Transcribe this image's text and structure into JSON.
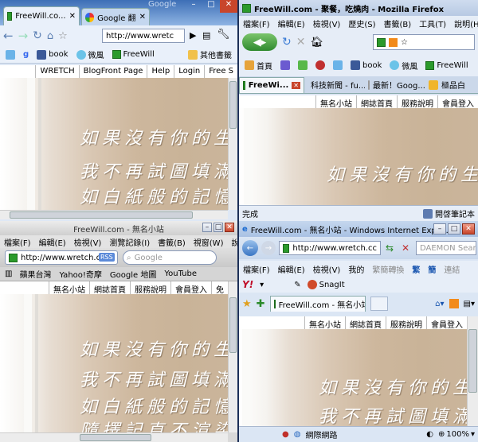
{
  "poem": {
    "line1": "如果沒有你的生命",
    "line2": "我不再試圖填滿色",
    "line3": "如白紙般的記憶，",
    "line4": "隨擇記直不渲染"
  },
  "chrome": {
    "tab1": "FreeWill.co...",
    "tab2": "Google 翻",
    "google_hint": "Google",
    "url": "http://www.wretc",
    "bookmarks": [
      "g",
      "book",
      "微風",
      "FreeWill"
    ],
    "other_bookmarks": "其他書籤",
    "nav_links": [
      "WRETCH",
      "BlogFront Page",
      "Help",
      "Login",
      "Free S"
    ]
  },
  "firefox": {
    "title": "FreeWill.com - 聚餐，吃燒肉 - Mozilla Firefox",
    "menu": [
      "檔案(F)",
      "編輯(E)",
      "檢視(V)",
      "歷史(S)",
      "書籤(B)",
      "工具(T)",
      "說明(H)"
    ],
    "bookmarks": [
      "首頁",
      "book",
      "微風",
      "FreeWill"
    ],
    "tabs": [
      "FreeWi...",
      "科技新聞 - fu...",
      "最新！Goog...",
      "極品白"
    ],
    "nav_links": [
      "無名小站",
      "網誌首頁",
      "服務說明",
      "會員登入"
    ],
    "status": "完成",
    "status_right": "開啓筆記本"
  },
  "safari": {
    "title": "FreeWill.com - 無名小站",
    "menu": [
      "檔案(F)",
      "編輯(E)",
      "檢視(V)",
      "瀏覽記錄(I)",
      "書籤(B)",
      "視窗(W)",
      "說明(H)"
    ],
    "url": "http://www.wretch.cc",
    "rss": "RSS",
    "search_placeholder": "Google",
    "bookmarks": [
      "蘋果台灣",
      "Yahoo!奇摩",
      "Google 地圖",
      "YouTube"
    ],
    "nav_links": [
      "無名小站",
      "網誌首頁",
      "服務說明",
      "會員登入",
      "免"
    ]
  },
  "ie": {
    "title": "FreeWill.com - 無名小站 - Windows Internet Explo...",
    "url": "http://www.wretch.cc",
    "search_placeholder": "DAEMON Search",
    "menu": [
      "檔案(F)",
      "編輯(E)",
      "檢視(V)",
      "我的",
      "繁簡轉換",
      "繁",
      "簡",
      "連結"
    ],
    "snagit": "SnagIt",
    "tab": "FreeWill.com - 無名小站",
    "nav_links": [
      "無名小站",
      "網誌首頁",
      "服務說明",
      "會員登入"
    ],
    "status_zone": "網際網路",
    "zoom": "100%"
  }
}
